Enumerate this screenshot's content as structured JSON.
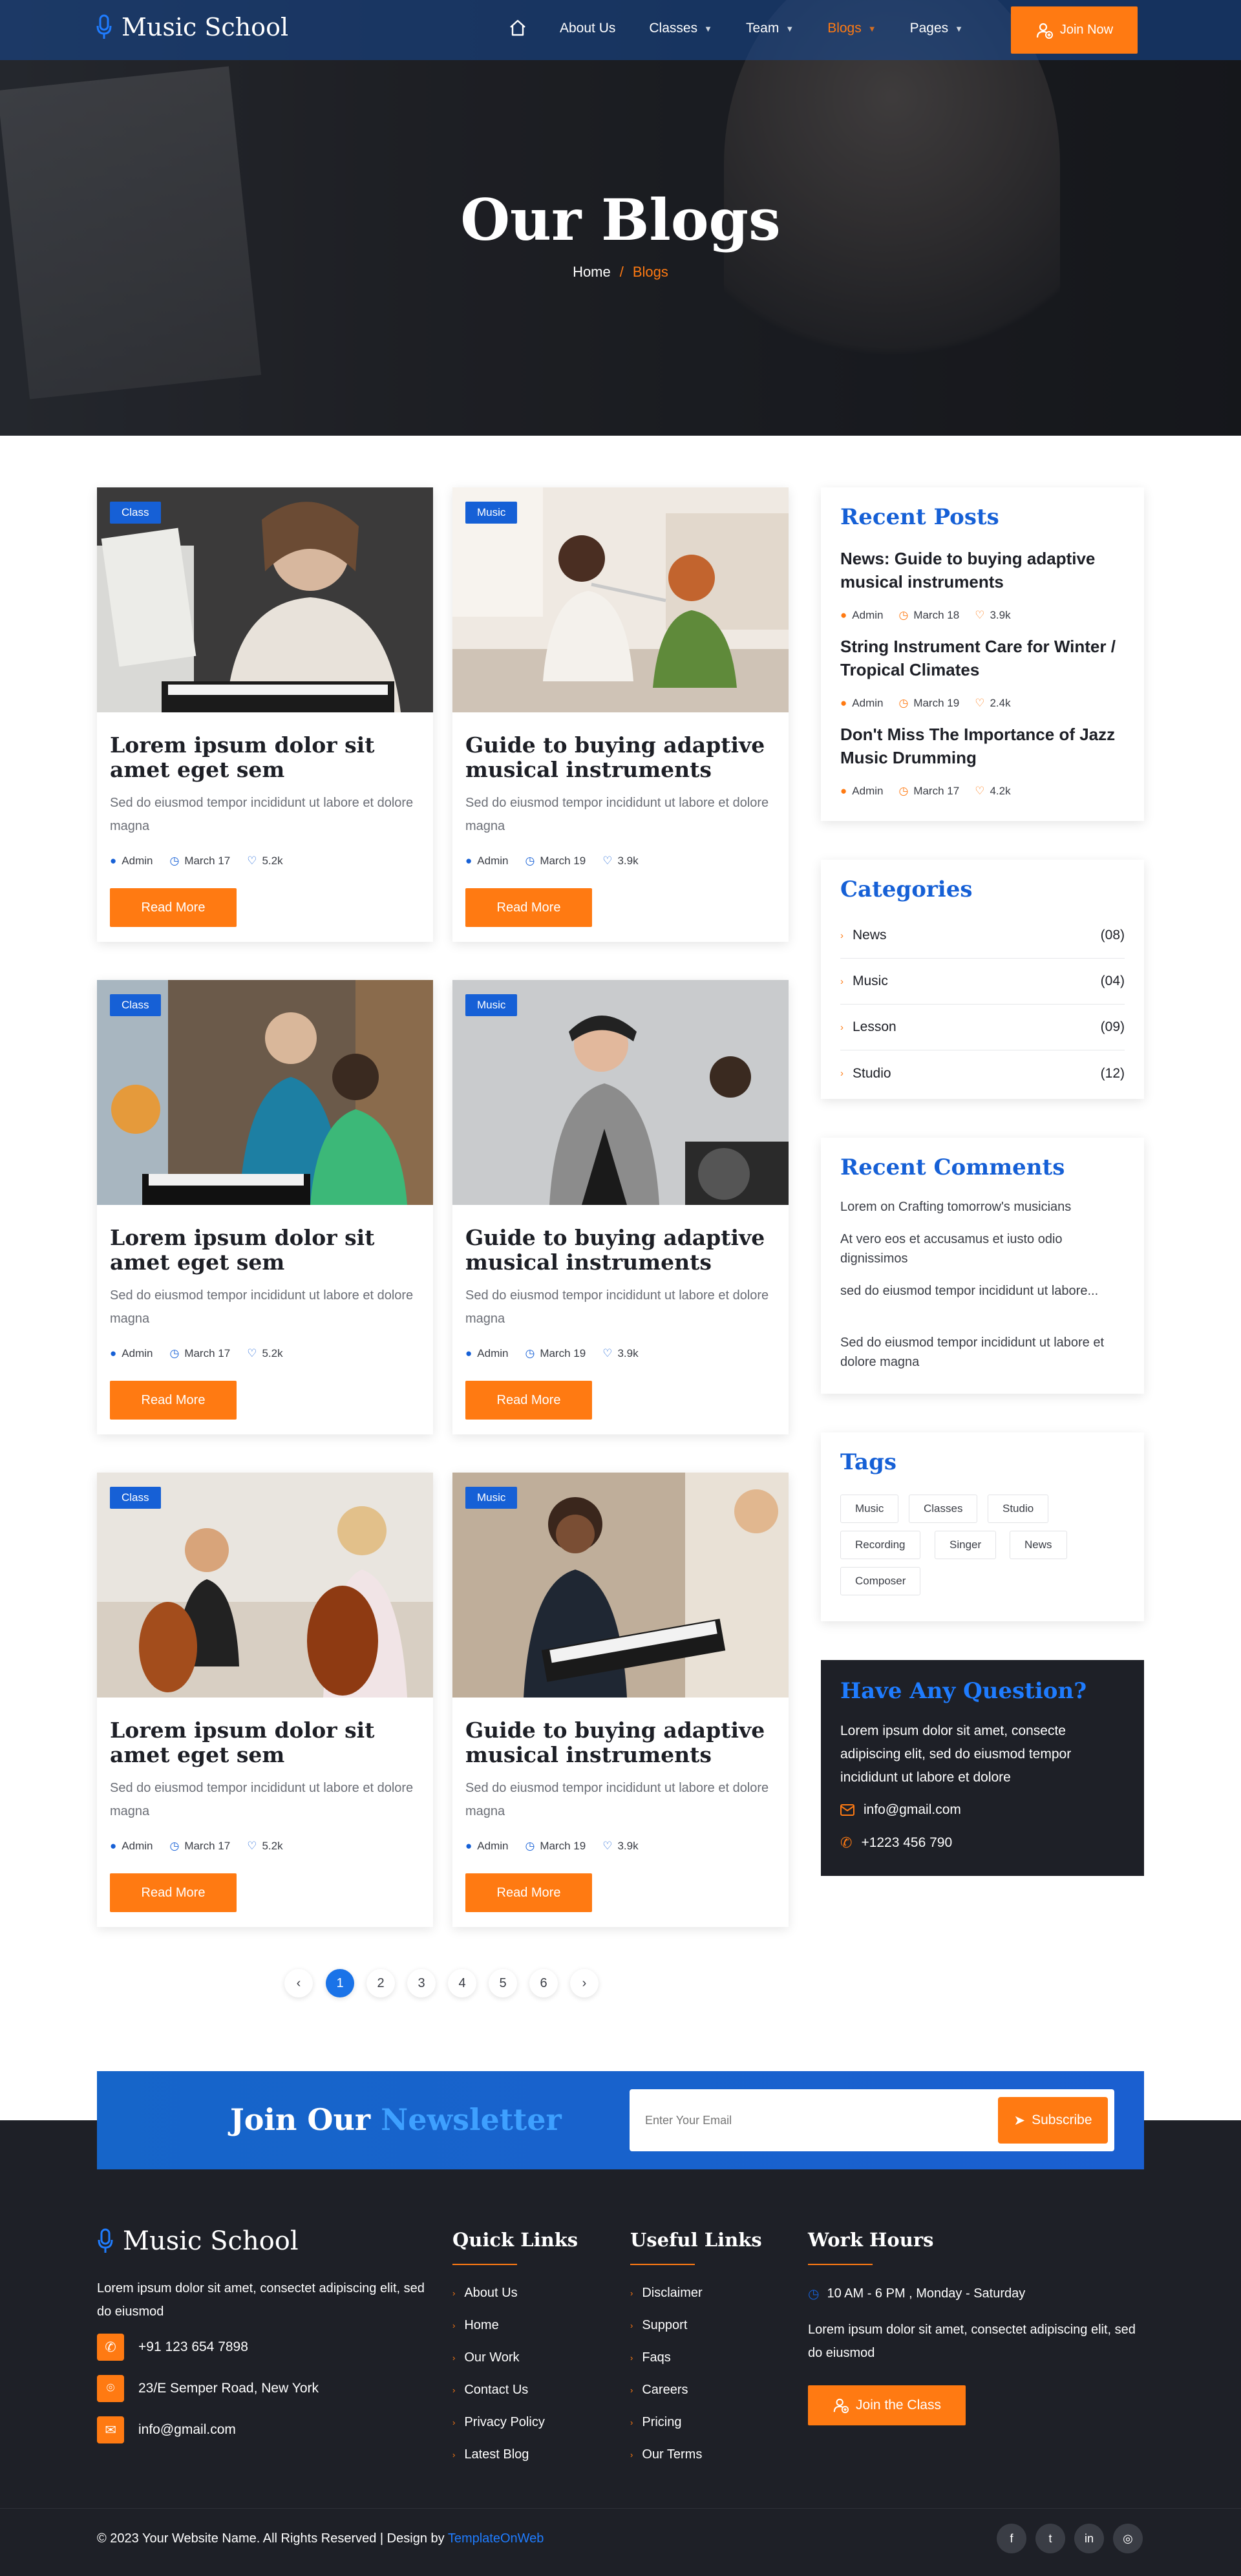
{
  "brand": {
    "name": "Music School"
  },
  "nav": {
    "items": [
      {
        "label": "About Us",
        "has_dropdown": false,
        "active": false
      },
      {
        "label": "Classes",
        "has_dropdown": true,
        "active": false
      },
      {
        "label": "Team",
        "has_dropdown": true,
        "active": false
      },
      {
        "label": "Blogs",
        "has_dropdown": true,
        "active": true
      },
      {
        "label": "Pages",
        "has_dropdown": true,
        "active": false
      }
    ],
    "cta": "Join Now"
  },
  "hero": {
    "title": "Our Blogs",
    "breadcrumb": {
      "home": "Home",
      "separator": "/",
      "current": "Blogs"
    }
  },
  "posts": [
    {
      "badge": "Class",
      "title": "Lorem ipsum dolor sit amet eget sem",
      "desc": "Sed do eiusmod tempor incididunt ut labore et dolore magna",
      "author": "Admin",
      "date": "March 17",
      "likes": "5.2k",
      "button": "Read More"
    },
    {
      "badge": "Music",
      "title": "Guide to buying adaptive musical instruments",
      "desc": "Sed do eiusmod tempor incididunt ut labore et dolore magna",
      "author": "Admin",
      "date": "March 19",
      "likes": "3.9k",
      "button": "Read More"
    },
    {
      "badge": "Class",
      "title": "Lorem ipsum dolor sit amet eget sem",
      "desc": "Sed do eiusmod tempor incididunt ut labore et dolore magna",
      "author": "Admin",
      "date": "March 17",
      "likes": "5.2k",
      "button": "Read More"
    },
    {
      "badge": "Music",
      "title": "Guide to buying adaptive musical instruments",
      "desc": "Sed do eiusmod tempor incididunt ut labore et dolore magna",
      "author": "Admin",
      "date": "March 19",
      "likes": "3.9k",
      "button": "Read More"
    },
    {
      "badge": "Class",
      "title": "Lorem ipsum dolor sit amet eget sem",
      "desc": "Sed do eiusmod tempor incididunt ut labore et dolore magna",
      "author": "Admin",
      "date": "March 17",
      "likes": "5.2k",
      "button": "Read More"
    },
    {
      "badge": "Music",
      "title": "Guide to buying adaptive musical instruments",
      "desc": "Sed do eiusmod tempor incididunt ut labore et dolore magna",
      "author": "Admin",
      "date": "March 19",
      "likes": "3.9k",
      "button": "Read More"
    }
  ],
  "pagination": {
    "pages": [
      "1",
      "2",
      "3",
      "4",
      "5",
      "6"
    ],
    "current": "1",
    "prev": "‹",
    "next": "›"
  },
  "sidebar": {
    "recent_posts": {
      "title": "Recent Posts",
      "items": [
        {
          "title": "News: Guide to buying adaptive musical instruments",
          "author": "Admin",
          "date": "March 18",
          "likes": "3.9k"
        },
        {
          "title": "String Instrument Care for Winter / Tropical Climates",
          "author": "Admin",
          "date": "March 19",
          "likes": "2.4k"
        },
        {
          "title": "Don't Miss The Importance of Jazz Music Drumming",
          "author": "Admin",
          "date": "March 17",
          "likes": "4.2k"
        }
      ]
    },
    "categories": {
      "title": "Categories",
      "items": [
        {
          "name": "News",
          "count": "(08)"
        },
        {
          "name": "Music",
          "count": "(04)"
        },
        {
          "name": "Lesson",
          "count": "(09)"
        },
        {
          "name": "Studio",
          "count": "(12)"
        }
      ]
    },
    "recent_comments": {
      "title": "Recent Comments",
      "items": [
        "Lorem on Crafting tomorrow's musicians",
        "At vero eos et accusamus et iusto odio dignissimos",
        "sed do eiusmod tempor incididunt ut labore...",
        "Sed do eiusmod tempor incididunt ut labore et dolore magna"
      ]
    },
    "tags": {
      "title": "Tags",
      "items": [
        "Music",
        "Classes",
        "Studio",
        "Recording",
        "Singer",
        "News",
        "Composer"
      ]
    },
    "question": {
      "title": "Have Any Question?",
      "desc": "Lorem ipsum dolor sit amet, consecte adipiscing elit, sed do eiusmod tempor incididunt ut labore et dolore",
      "email": "info@gmail.com",
      "phone": "+1223 456 790"
    }
  },
  "newsletter": {
    "title_plain": "Join Our",
    "title_accent": "Newsletter",
    "placeholder": "Enter Your Email",
    "button": "Subscribe"
  },
  "footer": {
    "brand": "Music School",
    "desc": "Lorem ipsum dolor sit amet, consectet adipiscing elit, sed do eiusmod",
    "phone": "+91 123 654 7898",
    "address": "23/E Semper Road, New York",
    "email": "info@gmail.com",
    "quick_links": {
      "title": "Quick Links",
      "items": [
        "About Us",
        "Home",
        "Our Work",
        "Contact Us",
        "Privacy Policy",
        "Latest Blog"
      ]
    },
    "useful_links": {
      "title": "Useful Links",
      "items": [
        "Disclaimer",
        "Support",
        "Faqs",
        "Careers",
        "Pricing",
        "Our Terms"
      ]
    },
    "work_hours": {
      "title": "Work Hours",
      "hours": "10 AM - 6 PM , Monday - Saturday",
      "desc": "Lorem ipsum dolor sit amet, consectet adipiscing elit, sed do eiusmod",
      "button": "Join the Class"
    },
    "copyright": "© 2023 Your Website Name. All Rights Reserved | Design by",
    "designer": "TemplateOnWeb",
    "social": [
      "facebook-icon",
      "twitter-icon",
      "linkedin-icon",
      "instagram-icon"
    ]
  },
  "colors": {
    "primary": "#1660d6",
    "accent": "#ff7a12",
    "dark": "#1e2027"
  }
}
